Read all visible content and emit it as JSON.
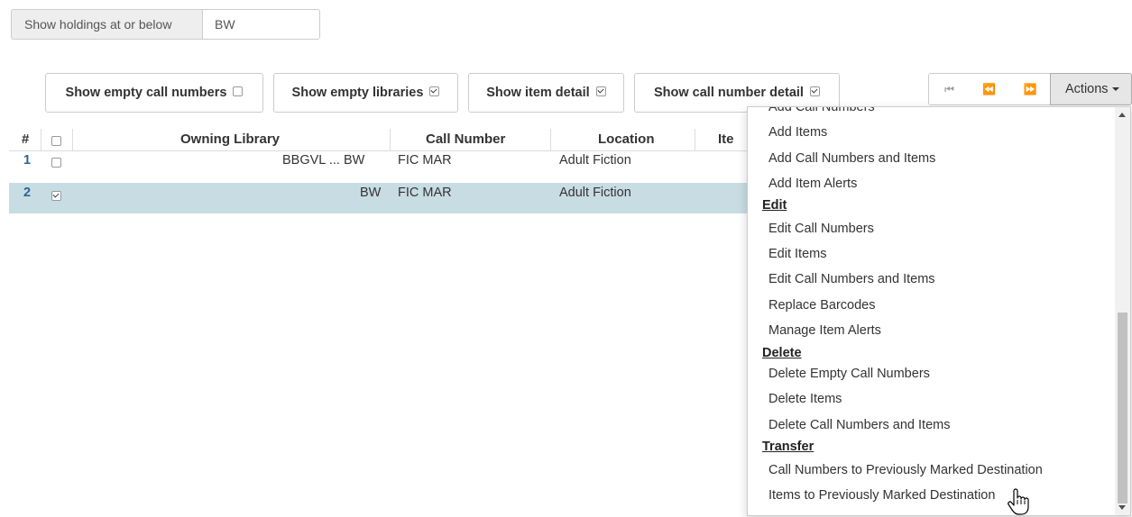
{
  "holdings_filter": {
    "label": "Show holdings at or below",
    "value": "BW"
  },
  "toggles": [
    {
      "label": "Show empty call numbers",
      "checked": false
    },
    {
      "label": "Show empty libraries",
      "checked": true
    },
    {
      "label": "Show item detail",
      "checked": true
    },
    {
      "label": "Show call number detail",
      "checked": true
    }
  ],
  "pager": {
    "first_icon": "first-page-icon",
    "prev_icon": "prev-page-icon",
    "next_icon": "next-page-icon",
    "first": "⏮",
    "prev": "⏪",
    "next": "⏩"
  },
  "actions_label": "Actions",
  "grid": {
    "columns": [
      "#",
      "Owning Library",
      "Call Number",
      "Location",
      "Ite"
    ],
    "rows": [
      {
        "num": "1",
        "checked": false,
        "library": "BBGVL ... BW",
        "call_number": "FIC MAR",
        "location": "Adult Fiction",
        "selected": false
      },
      {
        "num": "2",
        "checked": true,
        "library": "BW",
        "call_number": "FIC MAR",
        "location": "Adult Fiction",
        "selected": true
      }
    ]
  },
  "actions_menu": {
    "items": [
      {
        "type": "item",
        "label": "Add Call Numbers"
      },
      {
        "type": "item",
        "label": "Add Items"
      },
      {
        "type": "item",
        "label": "Add Call Numbers and Items"
      },
      {
        "type": "item",
        "label": "Add Item Alerts"
      },
      {
        "type": "header",
        "label": "Edit"
      },
      {
        "type": "item",
        "label": "Edit Call Numbers"
      },
      {
        "type": "item",
        "label": "Edit Items"
      },
      {
        "type": "item",
        "label": "Edit Call Numbers and Items"
      },
      {
        "type": "item",
        "label": "Replace Barcodes"
      },
      {
        "type": "item",
        "label": "Manage Item Alerts"
      },
      {
        "type": "header",
        "label": "Delete"
      },
      {
        "type": "item",
        "label": "Delete Empty Call Numbers"
      },
      {
        "type": "item",
        "label": "Delete Items"
      },
      {
        "type": "item",
        "label": "Delete Call Numbers and Items"
      },
      {
        "type": "header",
        "label": "Transfer"
      },
      {
        "type": "item",
        "label": "Call Numbers to Previously Marked Destination"
      },
      {
        "type": "item",
        "label": "Items to Previously Marked Destination"
      }
    ]
  },
  "cursor_icon": "hand-pointer-icon"
}
